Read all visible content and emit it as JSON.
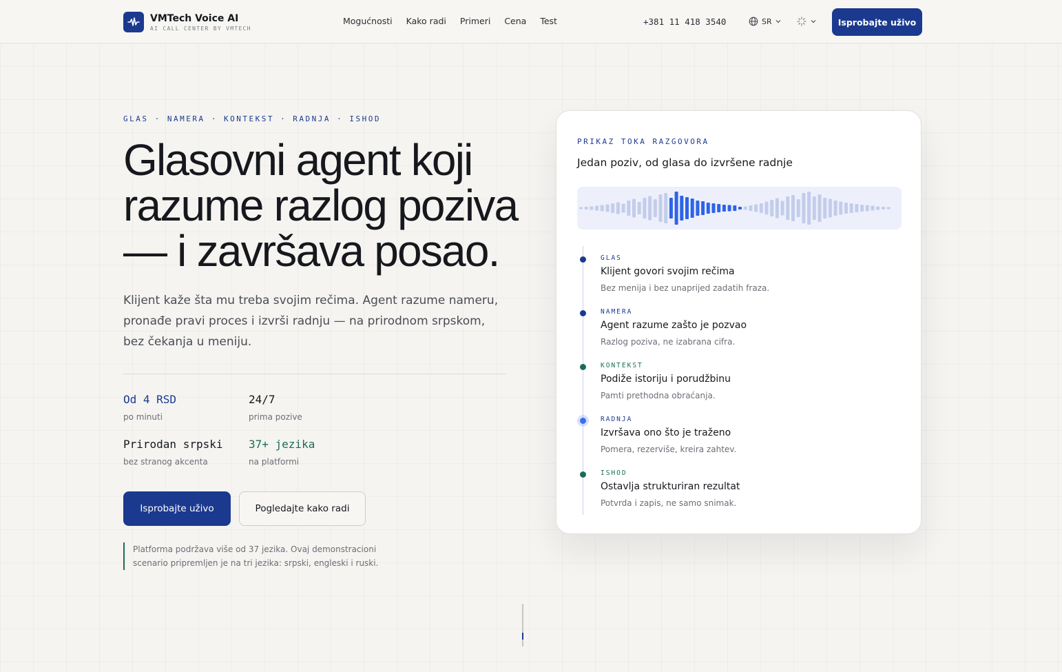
{
  "header": {
    "brand_name": "VMTech Voice AI",
    "brand_sub": "AI CALL CENTER BY VMTECH",
    "nav": [
      "Mogućnosti",
      "Kako radi",
      "Primeri",
      "Cena",
      "Test"
    ],
    "phone": "+381 11 418 3540",
    "lang": "SR",
    "cta": "Isprobajte uživo"
  },
  "hero": {
    "eyebrow": "GLAS · NAMERA · KONTEKST · RADNJA · ISHOD",
    "title_line1": "Glasovni agent koji",
    "title_line2": "razume razlog poziva",
    "title_line3": "— i završava posao.",
    "subtitle": "Klijent kaže šta mu treba svojim rečima. Agent razume nameru, pronađe pravi proces i izvrši radnju — na prirodnom srpskom, bez čekanja u meniju.",
    "stats": [
      {
        "value": "Od 4 RSD",
        "label": "po minuti",
        "color": "#1b3a8f"
      },
      {
        "value": "24/7",
        "label": "prima pozive",
        "color": "#16181d"
      },
      {
        "value": "Prirodan srpski",
        "label": "bez stranog akcenta",
        "color": "#16181d"
      },
      {
        "value": "37+ jezika",
        "label": "na platformi",
        "color": "#1b6b57"
      }
    ],
    "primary_button": "Isprobajte uživo",
    "secondary_button": "Pogledajte kako radi",
    "note": "Platforma podržava više od 37 jezika. Ovaj demonstracioni scenario pripremljen je na tri jezika: srpski, engleski i ruski."
  },
  "card": {
    "eyebrow": "PRIKAZ TOKA RAZGOVORA",
    "title": "Jedan poziv, od glasa do izvršene radnje",
    "steps": [
      {
        "tag": "GLAS",
        "title": "Klijent govori svojim rečima",
        "desc": "Bez menija i bez unaprijed zadatih fraza.",
        "color": "#1b3a8f"
      },
      {
        "tag": "NAMERA",
        "title": "Agent razume zašto je pozvao",
        "desc": "Razlog poziva, ne izabrana cifra.",
        "color": "#1b3a8f"
      },
      {
        "tag": "KONTEKST",
        "title": "Podiže istoriju i porudžbinu",
        "desc": "Pamti prethodna obraćanja.",
        "color": "#1b6b57"
      },
      {
        "tag": "RADNJA",
        "title": "Izvršava ono što je traženo",
        "desc": "Pomera, rezerviše, kreira zahtev.",
        "color": "#3b6df0"
      },
      {
        "tag": "ISHOD",
        "title": "Ostavlja strukturiran rezultat",
        "desc": "Potvrda i zapis, ne samo snimak.",
        "color": "#1b6b57"
      }
    ]
  },
  "colors": {
    "accent": "#1b3a8f",
    "green": "#1b6b57",
    "wave_active": "#2f63e8",
    "wave_idle": "#c3cdea"
  }
}
